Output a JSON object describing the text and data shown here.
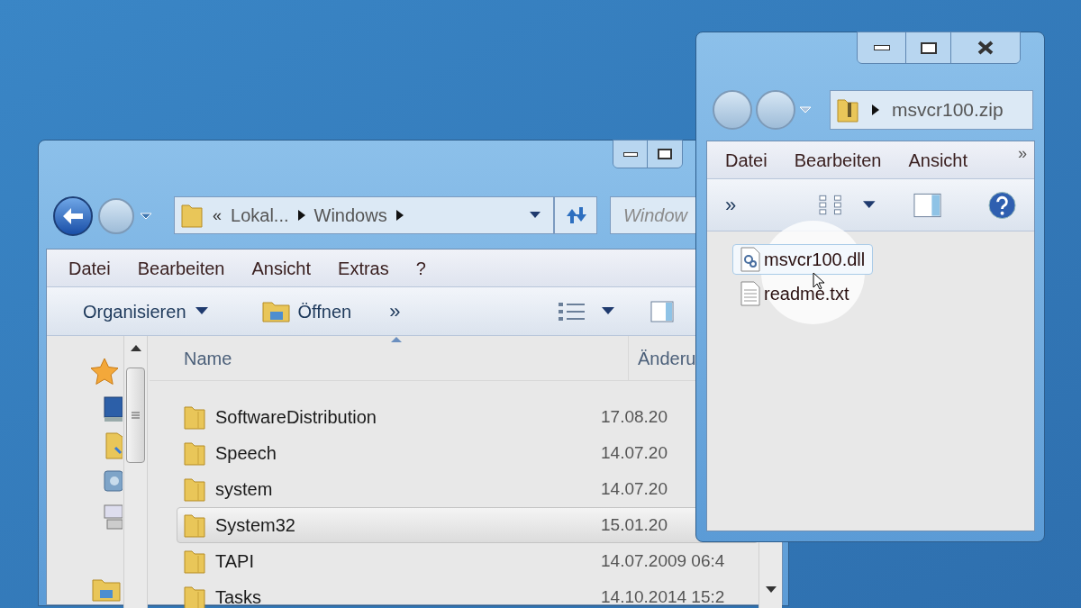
{
  "explorer": {
    "back_enabled": true,
    "address_overflow": "«",
    "address": [
      "Lokal...",
      "Windows"
    ],
    "search_placeholder": "Window",
    "menu": [
      "Datei",
      "Bearbeiten",
      "Ansicht",
      "Extras",
      "?"
    ],
    "toolbar": {
      "organize": "Organisieren",
      "open": "Öffnen",
      "more": "»"
    },
    "columns": [
      "Name",
      "Änderu"
    ],
    "rows": [
      {
        "name": "SoftwareDistribution",
        "date": "17.08.20",
        "selected": false
      },
      {
        "name": "Speech",
        "date": "14.07.20",
        "selected": false
      },
      {
        "name": "system",
        "date": "14.07.20",
        "selected": false
      },
      {
        "name": "System32",
        "date": "15.01.20",
        "selected": true
      },
      {
        "name": "TAPI",
        "date": "14.07.2009 06:4",
        "selected": false
      },
      {
        "name": "Tasks",
        "date": "14.10.2014 15:2",
        "selected": false
      }
    ]
  },
  "zip_window": {
    "back_enabled": false,
    "address": "msvcr100.zip",
    "menu": [
      "Datei",
      "Bearbeiten",
      "Ansicht"
    ],
    "menu_more": "»",
    "toolbar_more": "»",
    "files": [
      {
        "name": "msvcr100.dll",
        "kind": "dll",
        "selected": true
      },
      {
        "name": "readme.txt",
        "kind": "text",
        "selected": false
      }
    ]
  }
}
